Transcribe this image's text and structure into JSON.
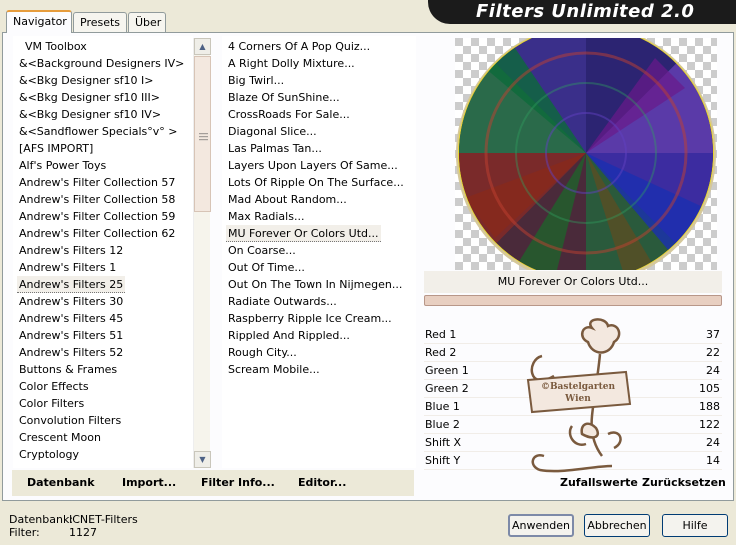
{
  "tabs": [
    {
      "label": "Navigator"
    },
    {
      "label": "Presets"
    },
    {
      "label": "Über"
    }
  ],
  "app_title": "Filters Unlimited 2.0",
  "categories": [
    "VM Toolbox",
    "&<Background Designers IV>",
    "&<Bkg Designer sf10 I>",
    "&<Bkg Designer sf10 III>",
    "&<Bkg Designer sf10 IV>",
    "&<Sandflower Specials°v° >",
    "[AFS IMPORT]",
    "Alf's Power Toys",
    "Andrew's Filter Collection 57",
    "Andrew's Filter Collection 58",
    "Andrew's Filter Collection 59",
    "Andrew's Filter Collection 62",
    "Andrew's Filters 12",
    "Andrew's Filters 1",
    "Andrew's Filters 25",
    "Andrew's Filters 30",
    "Andrew's Filters 45",
    "Andrew's Filters 51",
    "Andrew's Filters 52",
    "Buttons & Frames",
    "Color Effects",
    "Color Filters",
    "Convolution Filters",
    "Crescent Moon",
    "Cryptology"
  ],
  "filters": [
    "4 Corners Of A Pop Quiz...",
    "A Right Dolly Mixture...",
    "Big Twirl...",
    "Blaze Of SunShine...",
    "CrossRoads For Sale...",
    "Diagonal Slice...",
    "Las Palmas Tan...",
    "Layers Upon Layers Of Same...",
    "Lots Of Ripple On The Surface...",
    "Mad About Random...",
    "Max Radials...",
    "MU Forever Or Colors Utd...",
    "On Coarse...",
    "Out Of Time...",
    "Out On The Town In Nijmegen...",
    "Radiate Outwards...",
    "Raspberry Ripple Ice Cream...",
    "Rippled And Rippled...",
    "Rough City...",
    "Scream Mobile..."
  ],
  "selected_filter_name": "MU Forever Or Colors Utd...",
  "params": [
    {
      "label": "Red 1",
      "value": "37"
    },
    {
      "label": "Red 2",
      "value": "22"
    },
    {
      "label": "Green 1",
      "value": "24"
    },
    {
      "label": "Green 2",
      "value": "105"
    },
    {
      "label": "Blue 1",
      "value": "188"
    },
    {
      "label": "Blue 2",
      "value": "122"
    },
    {
      "label": "Shift X",
      "value": "24"
    },
    {
      "label": "Shift Y",
      "value": "14"
    }
  ],
  "bottom_bar": {
    "datenbank": "Datenbank",
    "import": "Import...",
    "filter_info": "Filter Info...",
    "editor": "Editor...",
    "zufallswerte": "Zufallswerte",
    "zuruecksetzen": "Zurücksetzen"
  },
  "status": {
    "datenbank_label": "Datenbank:",
    "datenbank_value": "ICNET-Filters",
    "filter_label": "Filter:",
    "filter_value": "1127"
  },
  "buttons": {
    "apply": "Anwenden",
    "cancel": "Abbrechen",
    "help": "Hilfe"
  },
  "watermark": "©Bastelgarten Wien",
  "colors": {
    "accent": "#e69c3c",
    "banner": "#1b1b1b"
  }
}
